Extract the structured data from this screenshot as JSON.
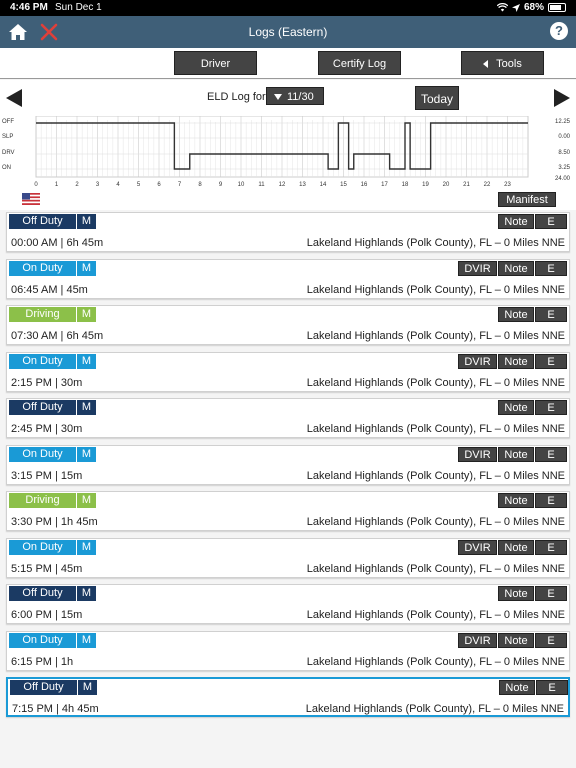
{
  "status_bar": {
    "time": "4:46 PM",
    "date": "Sun Dec 1",
    "battery": "68%"
  },
  "header": {
    "title": "Logs (Eastern)"
  },
  "toolbar": {
    "driver": "Driver",
    "certify": "Certify Log",
    "tools": "Tools"
  },
  "log": {
    "eld_label": "ELD Log for",
    "date": "11/30",
    "today": "Today",
    "manifest": "Manifest"
  },
  "graph": {
    "rows": [
      "OFF",
      "SLP",
      "DRV",
      "ON"
    ],
    "totals": [
      "12.25",
      "0.00",
      "8.50",
      "3.25"
    ],
    "total_sum": "24.00",
    "hours": [
      "0",
      "1",
      "2",
      "3",
      "4",
      "5",
      "6",
      "7",
      "8",
      "9",
      "10",
      "11",
      "12",
      "13",
      "14",
      "15",
      "16",
      "17",
      "18",
      "19",
      "20",
      "21",
      "22",
      "23"
    ],
    "segments": [
      {
        "start": 0,
        "end": 6.75,
        "row": 0
      },
      {
        "start": 6.75,
        "end": 7.5,
        "row": 3
      },
      {
        "start": 7.5,
        "end": 14.25,
        "row": 2
      },
      {
        "start": 14.25,
        "end": 14.75,
        "row": 3
      },
      {
        "start": 14.75,
        "end": 15.25,
        "row": 0
      },
      {
        "start": 15.25,
        "end": 15.5,
        "row": 3
      },
      {
        "start": 15.5,
        "end": 17.25,
        "row": 2
      },
      {
        "start": 17.25,
        "end": 18,
        "row": 3
      },
      {
        "start": 18,
        "end": 18.25,
        "row": 0
      },
      {
        "start": 18.25,
        "end": 19.25,
        "row": 3
      },
      {
        "start": 19.25,
        "end": 24,
        "row": 0
      }
    ]
  },
  "colors": {
    "off_duty": "#1b3a63",
    "on_duty": "#1a9ad6",
    "driving": "#8cc049"
  },
  "entries": [
    {
      "status": "Off Duty",
      "type": "off",
      "m": "M",
      "time": "00:00 AM | 6h 45m",
      "location": "Lakeland Highlands (Polk County), FL – 0 Miles NNE",
      "dvir": false
    },
    {
      "status": "On Duty",
      "type": "on",
      "m": "M",
      "time": "06:45 AM | 45m",
      "location": "Lakeland Highlands (Polk County), FL – 0 Miles NNE",
      "dvir": true
    },
    {
      "status": "Driving",
      "type": "drv",
      "m": "M",
      "time": "07:30 AM | 6h 45m",
      "location": "Lakeland Highlands (Polk County), FL – 0 Miles NNE",
      "dvir": false
    },
    {
      "status": "On Duty",
      "type": "on",
      "m": "M",
      "time": "2:15 PM | 30m",
      "location": "Lakeland Highlands (Polk County), FL – 0 Miles NNE",
      "dvir": true
    },
    {
      "status": "Off Duty",
      "type": "off",
      "m": "M",
      "time": "2:45 PM | 30m",
      "location": "Lakeland Highlands (Polk County), FL – 0 Miles NNE",
      "dvir": false
    },
    {
      "status": "On Duty",
      "type": "on",
      "m": "M",
      "time": "3:15 PM | 15m",
      "location": "Lakeland Highlands (Polk County), FL – 0 Miles NNE",
      "dvir": true
    },
    {
      "status": "Driving",
      "type": "drv",
      "m": "M",
      "time": "3:30 PM | 1h 45m",
      "location": "Lakeland Highlands (Polk County), FL – 0 Miles NNE",
      "dvir": false
    },
    {
      "status": "On Duty",
      "type": "on",
      "m": "M",
      "time": "5:15 PM | 45m",
      "location": "Lakeland Highlands (Polk County), FL – 0 Miles NNE",
      "dvir": true
    },
    {
      "status": "Off Duty",
      "type": "off",
      "m": "M",
      "time": "6:00 PM | 15m",
      "location": "Lakeland Highlands (Polk County), FL – 0 Miles NNE",
      "dvir": false
    },
    {
      "status": "On Duty",
      "type": "on",
      "m": "M",
      "time": "6:15 PM | 1h",
      "location": "Lakeland Highlands (Polk County), FL – 0 Miles NNE",
      "dvir": true
    },
    {
      "status": "Off Duty",
      "type": "off",
      "m": "M",
      "time": "7:15 PM | 4h 45m",
      "location": "Lakeland Highlands (Polk County), FL – 0 Miles NNE",
      "dvir": false,
      "selected": true
    }
  ],
  "buttons": {
    "dvir": "DVIR",
    "note": "Note",
    "e": "E"
  }
}
